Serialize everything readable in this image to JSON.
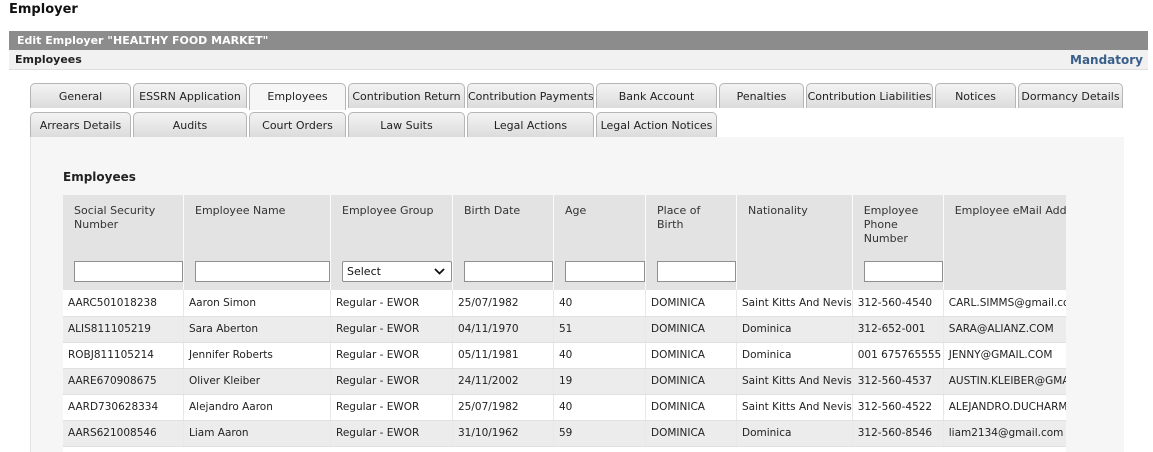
{
  "page": {
    "title": "Employer"
  },
  "panel": {
    "title": "Edit Employer \"HEALTHY FOOD MARKET\""
  },
  "section": {
    "label": "Employees",
    "mandatory": "Mandatory"
  },
  "tabs_row1": [
    {
      "label": "General"
    },
    {
      "label": "ESSRN Application"
    },
    {
      "label": "Employees",
      "active": true
    },
    {
      "label": "Contribution Return"
    },
    {
      "label": "Contribution Payments"
    },
    {
      "label": "Bank Account"
    },
    {
      "label": "Penalties"
    },
    {
      "label": "Contribution Liabilities"
    },
    {
      "label": "Notices"
    },
    {
      "label": "Dormancy Details"
    }
  ],
  "tabs_row2": [
    {
      "label": "Arrears Details"
    },
    {
      "label": "Audits"
    },
    {
      "label": "Court Orders"
    },
    {
      "label": "Law Suits"
    },
    {
      "label": "Legal Actions"
    },
    {
      "label": "Legal Action Notices"
    }
  ],
  "content": {
    "title": "Employees"
  },
  "grid": {
    "columns": [
      {
        "label": "Social Security Number"
      },
      {
        "label": "Employee Name"
      },
      {
        "label": "Employee Group"
      },
      {
        "label": "Birth Date"
      },
      {
        "label": "Age"
      },
      {
        "label": "Place of Birth"
      },
      {
        "label": "Nationality"
      },
      {
        "label": "Employee Phone Number"
      },
      {
        "label": "Employee eMail Address"
      }
    ],
    "filter_select": {
      "value": "Select"
    },
    "rows": [
      [
        "AARC501018238",
        "Aaron Simon",
        "Regular - EWOR",
        "25/07/1982",
        "40",
        "DOMINICA",
        "Saint Kitts And Nevis",
        "312-560-4540",
        "CARL.SIMMS@gmail.com"
      ],
      [
        "ALIS811105219",
        "Sara Aberton",
        "Regular - EWOR",
        "04/11/1970",
        "51",
        "DOMINICA",
        "Dominica",
        "312-652-001",
        "SARA@ALIANZ.COM"
      ],
      [
        "ROBJ811105214",
        "Jennifer Roberts",
        "Regular - EWOR",
        "05/11/1981",
        "40",
        "DOMINICA",
        "Dominica",
        "001 675765555",
        "JENNY@GMAIL.COM"
      ],
      [
        "AARE670908675",
        "Oliver Kleiber",
        "Regular - EWOR",
        "24/11/2002",
        "19",
        "DOMINICA",
        "Saint Kitts And Nevis",
        "312-560-4537",
        "AUSTIN.KLEIBER@GMAIL.COM"
      ],
      [
        "AARD730628334",
        "Alejandro Aaron",
        "Regular - EWOR",
        "25/07/1982",
        "40",
        "DOMINICA",
        "Saint Kitts And Nevis",
        "312-560-4522",
        "ALEJANDRO.DUCHARME@GMAIL.COM"
      ],
      [
        "AARS621008546",
        "Liam Aaron",
        "Regular - EWOR",
        "31/10/1962",
        "59",
        "DOMINICA",
        "Dominica",
        "312-560-8546",
        "liam2134@gmail.com"
      ]
    ]
  }
}
